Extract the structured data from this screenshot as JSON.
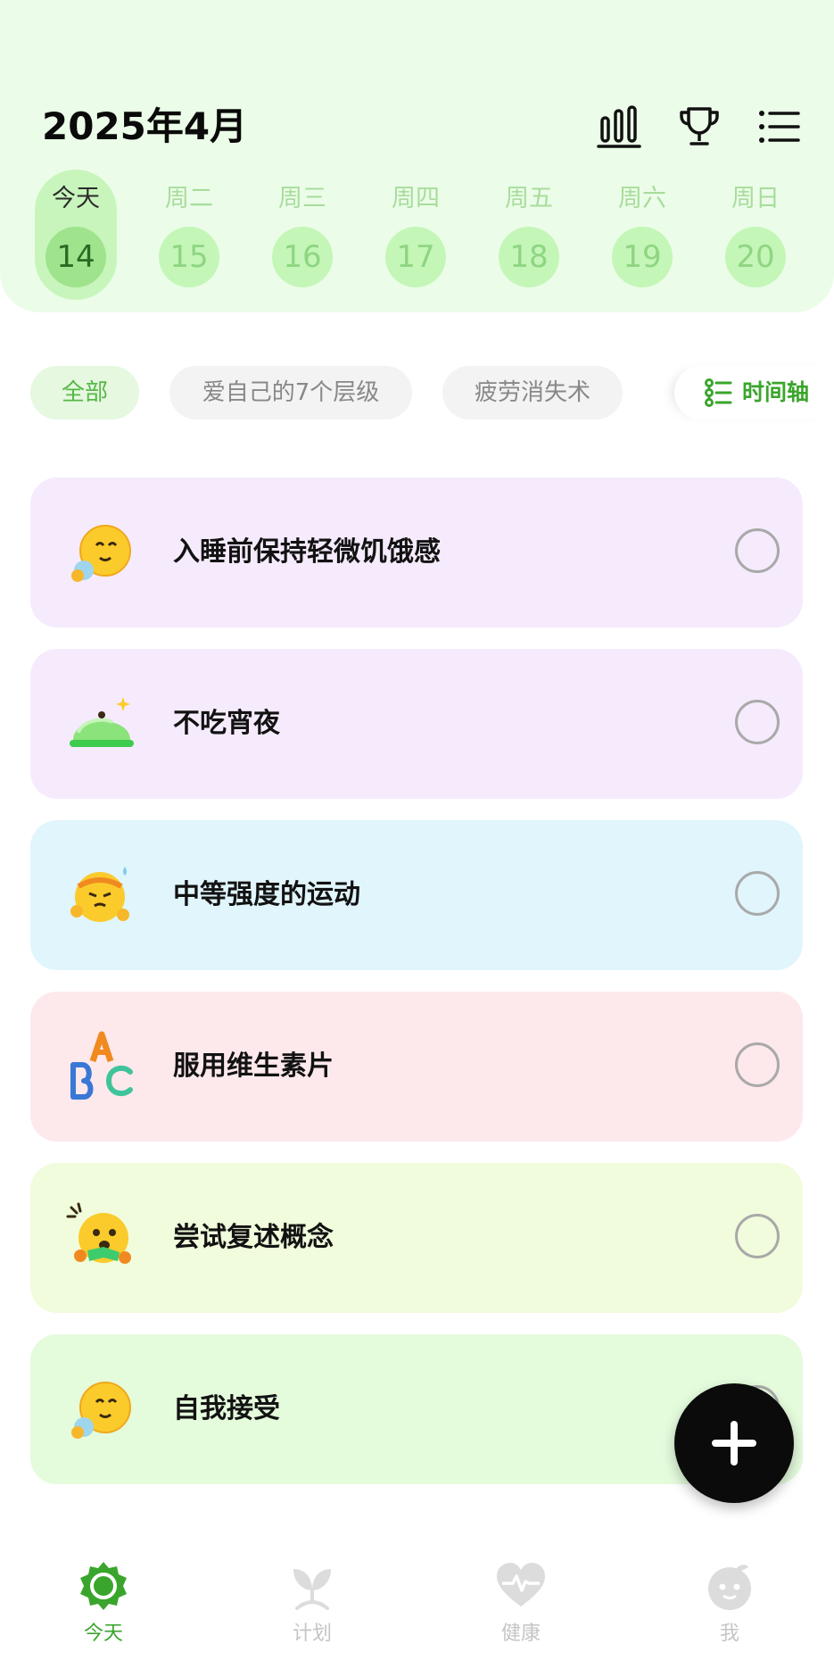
{
  "header": {
    "month_title": "2025年4月",
    "icons": [
      "stats-icon",
      "trophy-icon",
      "menu-icon"
    ]
  },
  "week": [
    {
      "label": "今天",
      "date": "14",
      "selected": true
    },
    {
      "label": "周二",
      "date": "15",
      "selected": false
    },
    {
      "label": "周三",
      "date": "16",
      "selected": false
    },
    {
      "label": "周四",
      "date": "17",
      "selected": false
    },
    {
      "label": "周五",
      "date": "18",
      "selected": false
    },
    {
      "label": "周六",
      "date": "19",
      "selected": false
    },
    {
      "label": "周日",
      "date": "20",
      "selected": false
    }
  ],
  "filters": {
    "chips": [
      {
        "label": "全部",
        "active": true
      },
      {
        "label": "爱自己的7个层级",
        "active": false
      },
      {
        "label": "疲劳消失术",
        "active": false
      }
    ],
    "timeline_label": "时间轴"
  },
  "habits": [
    {
      "name": "入睡前保持轻微饥饿感",
      "icon": "sleepy-face-icon",
      "bg": "#f6ebfd",
      "done": false
    },
    {
      "name": "不吃宵夜",
      "icon": "food-cover-icon",
      "bg": "#f6ebfd",
      "done": false
    },
    {
      "name": "中等强度的运动",
      "icon": "exercise-face-icon",
      "bg": "#e0f5fc",
      "done": false
    },
    {
      "name": "服用维生素片",
      "icon": "abc-letters-icon",
      "bg": "#fde8ec",
      "done": false
    },
    {
      "name": "尝试复述概念",
      "icon": "reading-face-icon",
      "bg": "#f0fcdc",
      "done": false
    },
    {
      "name": "自我接受",
      "icon": "sleepy-face-icon",
      "bg": "#e4fbdc",
      "done": false
    }
  ],
  "fab": {
    "icon": "plus-icon"
  },
  "bottom_nav": [
    {
      "label": "今天",
      "icon": "sun-icon",
      "active": true
    },
    {
      "label": "计划",
      "icon": "sprout-icon",
      "active": false
    },
    {
      "label": "健康",
      "icon": "heart-pulse-icon",
      "active": false
    },
    {
      "label": "我",
      "icon": "profile-face-icon",
      "active": false
    }
  ],
  "colors": {
    "accent": "#3aa52c",
    "header_bg": "#ebfde8"
  }
}
